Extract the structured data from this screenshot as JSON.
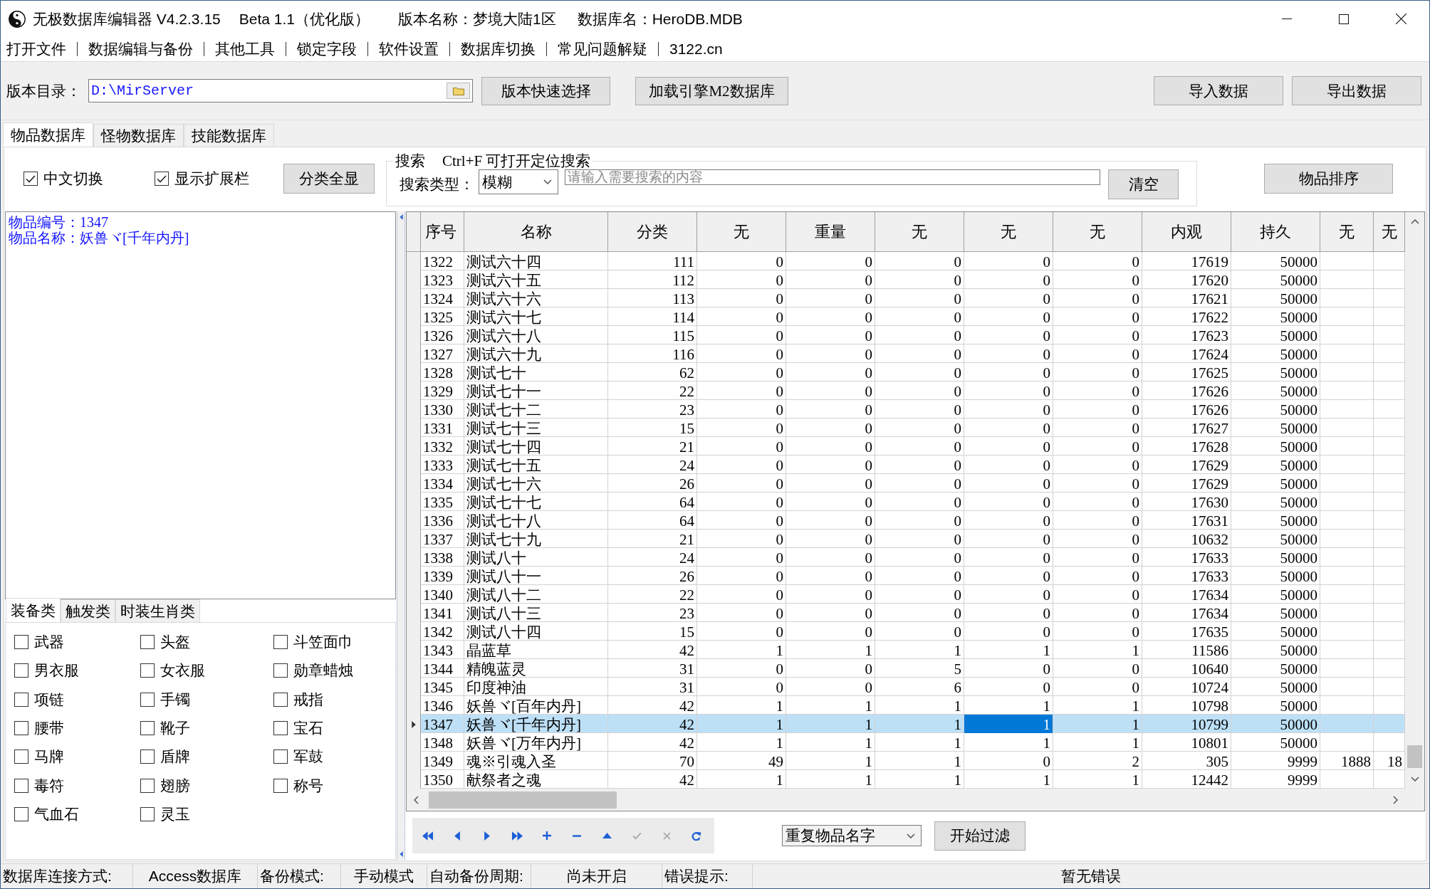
{
  "window": {
    "title_parts": [
      "无极数据库编辑器 V4.2.3.15",
      "Beta 1.1（优化版）",
      "版本名称：梦境大陆1区",
      "数据库名：HeroDB.MDB"
    ]
  },
  "menu": [
    "打开文件",
    "数据编辑与备份",
    "其他工具",
    "锁定字段",
    "软件设置",
    "数据库切换",
    "常见问题解疑",
    "3122.cn"
  ],
  "path_bar": {
    "label": "版本目录：",
    "value": "D:\\MirServer",
    "buttons": [
      "版本快速选择",
      "加载引擎M2数据库"
    ],
    "data_buttons": [
      "导入数据",
      "导出数据"
    ]
  },
  "tabs": [
    {
      "label": "物品数据库",
      "selected": true
    },
    {
      "label": "怪物数据库",
      "selected": false
    },
    {
      "label": "技能数据库",
      "selected": false
    }
  ],
  "options": {
    "checkboxes": [
      {
        "label": "中文切换",
        "checked": true
      },
      {
        "label": "显示扩展栏",
        "checked": true
      }
    ],
    "show_all_button": "分类全显"
  },
  "search": {
    "legend": "搜索",
    "hint": "Ctrl+F 可打开定位搜索",
    "type_label": "搜索类型：",
    "type_value": "模糊",
    "placeholder": "请输入需要搜索的内容",
    "clear_button": "清空"
  },
  "sort_button": "物品排序",
  "item_info": [
    "物品编号：1347",
    "物品名称：妖兽ヾ[千年内丹]"
  ],
  "category_tabs": [
    {
      "label": "装备类",
      "selected": true
    },
    {
      "label": "触发类",
      "selected": false
    },
    {
      "label": "时装生肖类",
      "selected": false
    }
  ],
  "categories": [
    {
      "label": "武器",
      "checked": false
    },
    {
      "label": "头盔",
      "checked": false
    },
    {
      "label": "斗笠面巾",
      "checked": false
    },
    {
      "label": "男衣服",
      "checked": false
    },
    {
      "label": "女衣服",
      "checked": false
    },
    {
      "label": "勋章蜡烛",
      "checked": false
    },
    {
      "label": "项链",
      "checked": false
    },
    {
      "label": "手镯",
      "checked": false
    },
    {
      "label": "戒指",
      "checked": false
    },
    {
      "label": "腰带",
      "checked": false
    },
    {
      "label": "靴子",
      "checked": false
    },
    {
      "label": "宝石",
      "checked": false
    },
    {
      "label": "马牌",
      "checked": false
    },
    {
      "label": "盾牌",
      "checked": false
    },
    {
      "label": "军鼓",
      "checked": false
    },
    {
      "label": "毒符",
      "checked": false
    },
    {
      "label": "翅膀",
      "checked": false
    },
    {
      "label": "称号",
      "checked": false
    },
    {
      "label": "气血石",
      "checked": false
    },
    {
      "label": "灵玉",
      "checked": false
    }
  ],
  "table": {
    "columns": [
      "序号",
      "名称",
      "分类",
      "无",
      "重量",
      "无",
      "无",
      "无",
      "内观",
      "持久",
      "无",
      "无"
    ],
    "rows": [
      {
        "selected": false,
        "cells": [
          "1322",
          "测试六十四",
          "111",
          "0",
          "0",
          "0",
          "0",
          "0",
          "17619",
          "50000"
        ]
      },
      {
        "selected": false,
        "cells": [
          "1323",
          "测试六十五",
          "112",
          "0",
          "0",
          "0",
          "0",
          "0",
          "17620",
          "50000"
        ]
      },
      {
        "selected": false,
        "cells": [
          "1324",
          "测试六十六",
          "113",
          "0",
          "0",
          "0",
          "0",
          "0",
          "17621",
          "50000"
        ]
      },
      {
        "selected": false,
        "cells": [
          "1325",
          "测试六十七",
          "114",
          "0",
          "0",
          "0",
          "0",
          "0",
          "17622",
          "50000"
        ]
      },
      {
        "selected": false,
        "cells": [
          "1326",
          "测试六十八",
          "115",
          "0",
          "0",
          "0",
          "0",
          "0",
          "17623",
          "50000"
        ]
      },
      {
        "selected": false,
        "cells": [
          "1327",
          "测试六十九",
          "116",
          "0",
          "0",
          "0",
          "0",
          "0",
          "17624",
          "50000"
        ]
      },
      {
        "selected": false,
        "cells": [
          "1328",
          "测试七十",
          "62",
          "0",
          "0",
          "0",
          "0",
          "0",
          "17625",
          "50000"
        ]
      },
      {
        "selected": false,
        "cells": [
          "1329",
          "测试七十一",
          "22",
          "0",
          "0",
          "0",
          "0",
          "0",
          "17626",
          "50000"
        ]
      },
      {
        "selected": false,
        "cells": [
          "1330",
          "测试七十二",
          "23",
          "0",
          "0",
          "0",
          "0",
          "0",
          "17626",
          "50000"
        ]
      },
      {
        "selected": false,
        "cells": [
          "1331",
          "测试七十三",
          "15",
          "0",
          "0",
          "0",
          "0",
          "0",
          "17627",
          "50000"
        ]
      },
      {
        "selected": false,
        "cells": [
          "1332",
          "测试七十四",
          "21",
          "0",
          "0",
          "0",
          "0",
          "0",
          "17628",
          "50000"
        ]
      },
      {
        "selected": false,
        "cells": [
          "1333",
          "测试七十五",
          "24",
          "0",
          "0",
          "0",
          "0",
          "0",
          "17629",
          "50000"
        ]
      },
      {
        "selected": false,
        "cells": [
          "1334",
          "测试七十六",
          "26",
          "0",
          "0",
          "0",
          "0",
          "0",
          "17629",
          "50000"
        ]
      },
      {
        "selected": false,
        "cells": [
          "1335",
          "测试七十七",
          "64",
          "0",
          "0",
          "0",
          "0",
          "0",
          "17630",
          "50000"
        ]
      },
      {
        "selected": false,
        "cells": [
          "1336",
          "测试七十八",
          "64",
          "0",
          "0",
          "0",
          "0",
          "0",
          "17631",
          "50000"
        ]
      },
      {
        "selected": false,
        "cells": [
          "1337",
          "测试七十九",
          "21",
          "0",
          "0",
          "0",
          "0",
          "0",
          "10632",
          "50000"
        ]
      },
      {
        "selected": false,
        "cells": [
          "1338",
          "测试八十",
          "24",
          "0",
          "0",
          "0",
          "0",
          "0",
          "17633",
          "50000"
        ]
      },
      {
        "selected": false,
        "cells": [
          "1339",
          "测试八十一",
          "26",
          "0",
          "0",
          "0",
          "0",
          "0",
          "17633",
          "50000"
        ]
      },
      {
        "selected": false,
        "cells": [
          "1340",
          "测试八十二",
          "22",
          "0",
          "0",
          "0",
          "0",
          "0",
          "17634",
          "50000"
        ]
      },
      {
        "selected": false,
        "cells": [
          "1341",
          "测试八十三",
          "23",
          "0",
          "0",
          "0",
          "0",
          "0",
          "17634",
          "50000"
        ]
      },
      {
        "selected": false,
        "cells": [
          "1342",
          "测试八十四",
          "15",
          "0",
          "0",
          "0",
          "0",
          "0",
          "17635",
          "50000"
        ]
      },
      {
        "selected": false,
        "cells": [
          "1343",
          "晶蓝草",
          "42",
          "1",
          "1",
          "1",
          "1",
          "1",
          "11586",
          "50000"
        ]
      },
      {
        "selected": false,
        "cells": [
          "1344",
          "精魄蓝灵",
          "31",
          "0",
          "0",
          "5",
          "0",
          "0",
          "10640",
          "50000"
        ]
      },
      {
        "selected": false,
        "cells": [
          "1345",
          "印度神油",
          "31",
          "0",
          "0",
          "6",
          "0",
          "0",
          "10724",
          "50000"
        ]
      },
      {
        "selected": false,
        "cells": [
          "1346",
          "妖兽ヾ[百年内丹]",
          "42",
          "1",
          "1",
          "1",
          "1",
          "1",
          "10798",
          "50000"
        ]
      },
      {
        "selected": true,
        "cells": [
          "1347",
          "妖兽ヾ[千年内丹]",
          "42",
          "1",
          "1",
          "1",
          {
            "text": "1",
            "focused": true
          },
          "1",
          "10799",
          "50000"
        ]
      },
      {
        "selected": false,
        "cells": [
          "1348",
          "妖兽ヾ[万年内丹]",
          "42",
          "1",
          "1",
          "1",
          "1",
          "1",
          "10801",
          "50000"
        ]
      },
      {
        "selected": false,
        "cells": [
          "1349",
          "魂※引魂入圣",
          "70",
          "49",
          "1",
          "1",
          "0",
          "2",
          "305",
          "9999",
          "1888",
          "18"
        ]
      },
      {
        "selected": false,
        "cells": [
          "1350",
          "献祭者之魂",
          "42",
          "1",
          "1",
          "1",
          "1",
          "1",
          "12442",
          "9999"
        ]
      }
    ]
  },
  "navigator": [
    {
      "kind": "first",
      "disabled": false
    },
    {
      "kind": "prior",
      "disabled": false
    },
    {
      "kind": "next",
      "disabled": false
    },
    {
      "kind": "last",
      "disabled": false
    },
    {
      "kind": "insert",
      "disabled": false
    },
    {
      "kind": "delete",
      "disabled": false
    },
    {
      "kind": "edit",
      "disabled": false
    },
    {
      "kind": "post",
      "disabled": true
    },
    {
      "kind": "cancel",
      "disabled": true
    },
    {
      "kind": "refresh",
      "disabled": false
    }
  ],
  "filter": {
    "value": "重复物品名字",
    "button": "开始过滤"
  },
  "status_bar": [
    {
      "kind": "label",
      "text": "数据库连接方式:"
    },
    {
      "kind": "value",
      "text": "Access数据库"
    },
    {
      "kind": "label",
      "text": "备份模式:"
    },
    {
      "kind": "value",
      "text": "手动模式"
    },
    {
      "kind": "label",
      "text": "自动备份周期:"
    },
    {
      "kind": "value",
      "text": "尚未开启"
    },
    {
      "kind": "label",
      "text": "错误提示:"
    },
    {
      "kind": "value",
      "text": "暂无错误"
    }
  ]
}
